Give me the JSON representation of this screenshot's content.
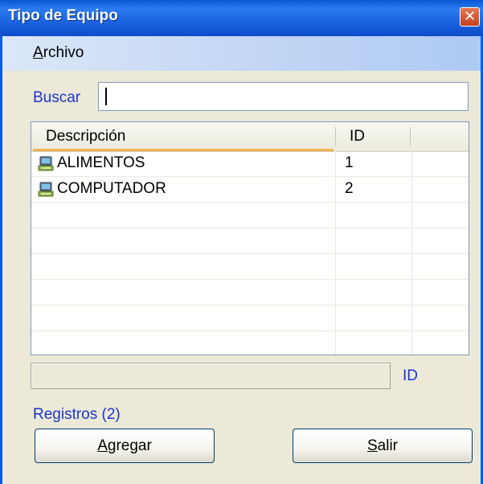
{
  "window": {
    "title": "Tipo de Equipo",
    "close_glyph": "✕"
  },
  "menu": {
    "archivo_accel": "A",
    "archivo_rest": "rchivo"
  },
  "search": {
    "label": "Buscar",
    "value": ""
  },
  "table": {
    "columns": [
      "Descripción",
      "ID"
    ],
    "rows": [
      {
        "descripcion": "ALIMENTOS",
        "id": "1",
        "icon": "computer-icon"
      },
      {
        "descripcion": "COMPUTADOR",
        "id": "2",
        "icon": "computer-icon"
      }
    ]
  },
  "detail": {
    "id_label": "ID"
  },
  "status": {
    "registros": "Registros (2)"
  },
  "buttons": {
    "agregar_accel": "A",
    "agregar_rest": "gregar",
    "salir_accel": "S",
    "salir_rest": "alir"
  },
  "colors": {
    "title_blue": "#0a55d4",
    "label_blue": "#1a35c8",
    "sort_orange": "#e9a23a"
  }
}
